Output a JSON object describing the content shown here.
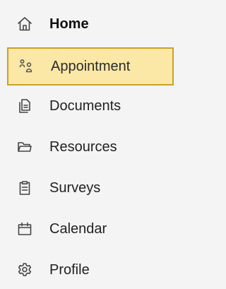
{
  "nav": {
    "items": [
      {
        "label": "Home",
        "icon": "home-icon"
      },
      {
        "label": "Appointment",
        "icon": "people-icon",
        "active": true
      },
      {
        "label": "Documents",
        "icon": "documents-icon"
      },
      {
        "label": "Resources",
        "icon": "folder-icon"
      },
      {
        "label": "Surveys",
        "icon": "clipboard-icon"
      },
      {
        "label": "Calendar",
        "icon": "calendar-icon"
      },
      {
        "label": "Profile",
        "icon": "gear-icon"
      }
    ]
  },
  "colors": {
    "background": "#f4f4f4",
    "active_fill": "#fbe7a6",
    "active_border": "#c9a227",
    "text": "#222222",
    "icon": "#444444"
  }
}
